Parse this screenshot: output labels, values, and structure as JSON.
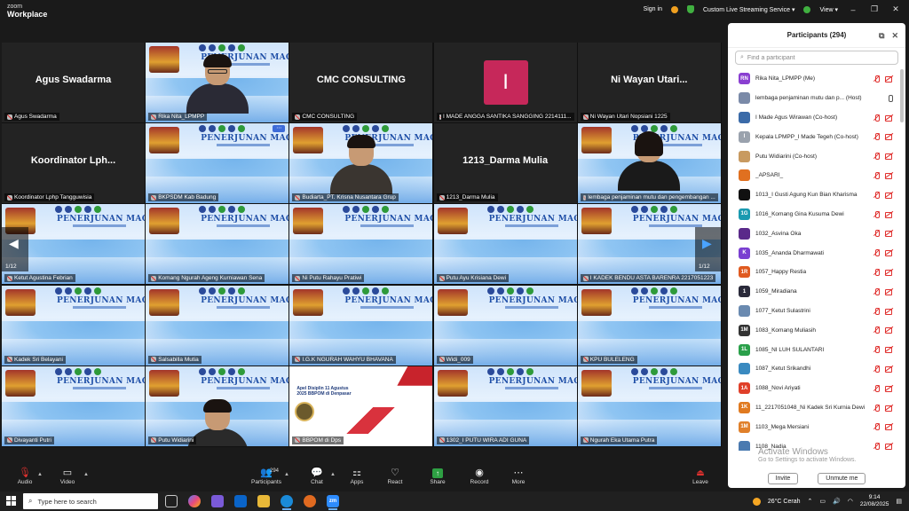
{
  "app": {
    "brand_line1": "zoom",
    "brand_line2": "Workplace"
  },
  "titlebar": {
    "sign_in": "Sign in",
    "streaming": "Custom Live Streaming Service",
    "view": "View",
    "minimize": "–",
    "restore": "❐",
    "close": "✕"
  },
  "tiles": [
    {
      "label": "Agus Swadarma",
      "big": "Agus Swadarma",
      "kind": "name"
    },
    {
      "label": "Rika Nita_LPMPP",
      "kind": "person"
    },
    {
      "label": "CMC CONSULTING",
      "big": "CMC CONSULTING",
      "kind": "name"
    },
    {
      "label": "I MADE ANGGA SANTIKA SANGGING 2214111...",
      "letter": "I",
      "kind": "letter"
    },
    {
      "label": "Ni Wayan Utari Nopsiani 1225",
      "big": "Ni Wayan Utari...",
      "kind": "name"
    },
    {
      "label": "Koordinator Lphp Tangguwisia",
      "big": "Koordinator Lph...",
      "kind": "name"
    },
    {
      "label": "BKPSDM Kab Badung",
      "kind": "banner"
    },
    {
      "label": "Budiarta_PT. Krisna Nusantara Grup",
      "kind": "person"
    },
    {
      "label": "1213_Darma Mulia",
      "big": "1213_Darma Mulia",
      "kind": "name"
    },
    {
      "label": "lembaga penjaminan mutu dan pengembangan ...",
      "kind": "person-active"
    },
    {
      "label": "Ketut Agustina Febrian",
      "kind": "banner"
    },
    {
      "label": "Komang Ngurah Ageng Kurniawan Sena",
      "kind": "banner"
    },
    {
      "label": "Ni Putu Rahayu Pratiwi",
      "kind": "banner"
    },
    {
      "label": "Putu Ayu Krisiana Dewi",
      "kind": "banner"
    },
    {
      "label": "I KADEK BENDU ASTA BARENRA 2217051223",
      "kind": "banner"
    },
    {
      "label": "Kadek Sri Belayani",
      "kind": "banner"
    },
    {
      "label": "Salsabilla Mutia",
      "kind": "banner"
    },
    {
      "label": "I.G.K NGURAH WAHYU BHAVANA",
      "kind": "banner"
    },
    {
      "label": "Widi_009",
      "kind": "banner"
    },
    {
      "label": "KPU BULELENG",
      "kind": "banner"
    },
    {
      "label": "Divayanti Putri",
      "kind": "banner"
    },
    {
      "label": "Putu Widiarini",
      "kind": "banner-person"
    },
    {
      "label": "BBPOM di Dps",
      "kind": "poster"
    },
    {
      "label": "1302_I PUTU WIRA ADI GUNA",
      "kind": "banner"
    },
    {
      "label": "Ngurah Eka Utama Putra",
      "kind": "banner"
    }
  ],
  "banner_title": "PENERJUNAN MAGANG",
  "poster_text": "Apel Disiplin 11 Agustus 2025 BBPOM di Denpasar",
  "pager": {
    "left": "1/12",
    "right": "1/12"
  },
  "panel": {
    "title": "Participants (294)",
    "search_placeholder": "Find a participant",
    "participants": [
      {
        "name": "Rika Nita_LPMPP (Me)",
        "avatar": "RN",
        "color": "#8a3fd1",
        "video": "off"
      },
      {
        "name": "lembaga penjaminan mutu dan p... (Host)",
        "avatar": "",
        "color": "#7a8aa8",
        "video": "on-mic"
      },
      {
        "name": "I Made Agus Wirawan (Co-host)",
        "avatar": "",
        "color": "#3a6aa8",
        "video": "off"
      },
      {
        "name": "Kepala LPMPP_I Made Tegeh (Co-host)",
        "avatar": "I",
        "color": "#9aa2ad",
        "video": "off"
      },
      {
        "name": "Putu Widiarini (Co-host)",
        "avatar": "",
        "color": "#c89a60",
        "video": "off"
      },
      {
        "name": "_APSARI_",
        "avatar": "",
        "color": "#e07020",
        "video": "off"
      },
      {
        "name": "1013_I Gusti Agung Kun Bian Kharisma",
        "avatar": "",
        "color": "#111111",
        "video": "off"
      },
      {
        "name": "1016_Komang Gina Kusuma Dewi",
        "avatar": "1G",
        "color": "#1a9ab0",
        "video": "off"
      },
      {
        "name": "1032_Asvina Oka",
        "avatar": "",
        "color": "#5a2a8a",
        "video": "off"
      },
      {
        "name": "1035_Ananda Dharmawati",
        "avatar": "K",
        "color": "#7a3fd1",
        "video": "off"
      },
      {
        "name": "1057_Happy Restia",
        "avatar": "1R",
        "color": "#e05a20",
        "video": "off"
      },
      {
        "name": "1059_Miradiana",
        "avatar": "1",
        "color": "#2a2a3a",
        "video": "off"
      },
      {
        "name": "1077_Ketut Sulastrini",
        "avatar": "",
        "color": "#6a8ab0",
        "video": "off"
      },
      {
        "name": "1083_Komang Muliasih",
        "avatar": "1M",
        "color": "#333333",
        "video": "off"
      },
      {
        "name": "1085_NI LUH SULANTARI",
        "avatar": "1L",
        "color": "#2aa04a",
        "video": "off"
      },
      {
        "name": "1087_Ketut Srikandhi",
        "avatar": "",
        "color": "#3a8ac0",
        "video": "off"
      },
      {
        "name": "1088_Novi Ariyati",
        "avatar": "1A",
        "color": "#e0402a",
        "video": "off"
      },
      {
        "name": "11_2217051048_Ni Kadek Sri Kurnia Dewi",
        "avatar": "1K",
        "color": "#e07a20",
        "video": "off"
      },
      {
        "name": "1103_Mega Mersiani",
        "avatar": "1M",
        "color": "#e0802a",
        "video": "off"
      },
      {
        "name": "1108_Nadia",
        "avatar": "",
        "color": "#4a7ab0",
        "video": "off"
      }
    ],
    "watermark_1": "Activate Windows",
    "watermark_2": "Go to Settings to activate Windows.",
    "invite": "Invite",
    "unmute_me": "Unmute me"
  },
  "toolbar": {
    "audio": "Audio",
    "video": "Video",
    "participants": "Participants",
    "participants_count": "294",
    "chat": "Chat",
    "apps": "Apps",
    "react": "React",
    "share": "Share",
    "record": "Record",
    "more": "More",
    "leave": "Leave"
  },
  "taskbar": {
    "search_placeholder": "Type here to search",
    "weather": "26°C  Cerah",
    "time": "9:14",
    "date": "22/08/2025",
    "zoom_app": "zm"
  }
}
